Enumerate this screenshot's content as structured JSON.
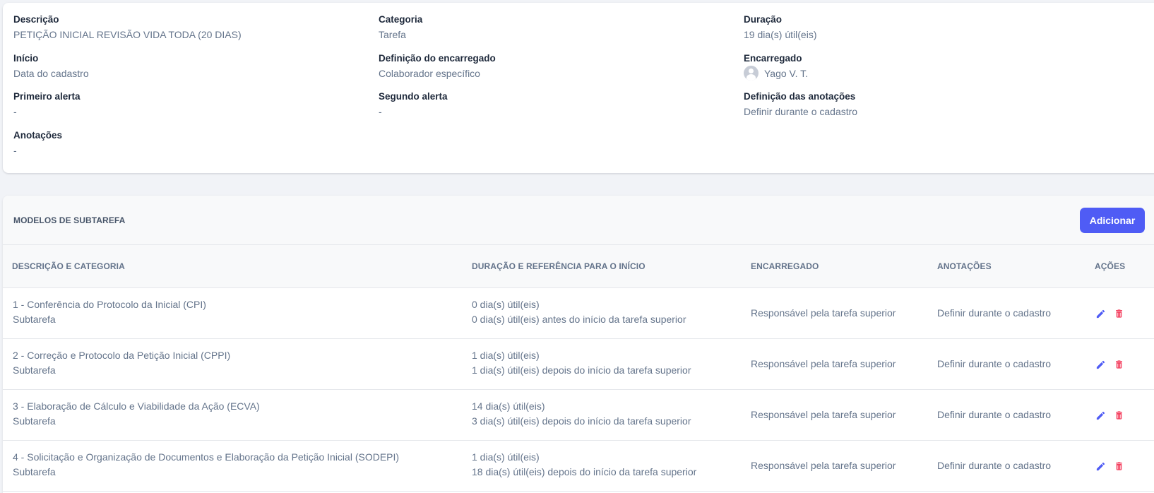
{
  "details": {
    "descricao": {
      "label": "Descrição",
      "value": "PETIÇÃO INICIAL REVISÃO VIDA TODA (20 DIAS)"
    },
    "categoria": {
      "label": "Categoria",
      "value": "Tarefa"
    },
    "duracao": {
      "label": "Duração",
      "value": "19 dia(s) útil(eis)"
    },
    "inicio": {
      "label": "Início",
      "value": "Data do cadastro"
    },
    "definicao_encarregado": {
      "label": "Definição do encarregado",
      "value": "Colaborador específico"
    },
    "encarregado": {
      "label": "Encarregado",
      "value": "Yago V. T."
    },
    "primeiro_alerta": {
      "label": "Primeiro alerta",
      "value": "-"
    },
    "segundo_alerta": {
      "label": "Segundo alerta",
      "value": "-"
    },
    "definicao_anotacoes": {
      "label": "Definição das anotações",
      "value": "Definir durante o cadastro"
    },
    "anotacoes": {
      "label": "Anotações",
      "value": "-"
    }
  },
  "subtasks": {
    "title": "MODELOS DE SUBTAREFA",
    "add_label": "Adicionar",
    "columns": [
      "DESCRIÇÃO E CATEGORIA",
      "DURAÇÃO E REFERÊNCIA PARA O INÍCIO",
      "ENCARREGADO",
      "ANOTAÇÕES",
      "AÇÕES"
    ],
    "rows": [
      {
        "description": "1 - Conferência do Protocolo da Inicial (CPI)",
        "category": "Subtarefa",
        "duration": "0 dia(s) útil(eis)",
        "reference": "0 dia(s) útil(eis) antes do início da tarefa superior",
        "assignee": "Responsável pela tarefa superior",
        "notes": "Definir durante o cadastro"
      },
      {
        "description": "2 - Correção e Protocolo da Petição Inicial (CPPI)",
        "category": "Subtarefa",
        "duration": "1 dia(s) útil(eis)",
        "reference": "1 dia(s) útil(eis) depois do início da tarefa superior",
        "assignee": "Responsável pela tarefa superior",
        "notes": "Definir durante o cadastro"
      },
      {
        "description": "3 - Elaboração de Cálculo e Viabilidade da Ação (ECVA)",
        "category": "Subtarefa",
        "duration": "14 dia(s) útil(eis)",
        "reference": "3 dia(s) útil(eis) depois do início da tarefa superior",
        "assignee": "Responsável pela tarefa superior",
        "notes": "Definir durante o cadastro"
      },
      {
        "description": "4 - Solicitação e Organização de Documentos e Elaboração da Petição Inicial (SODEPI)",
        "category": "Subtarefa",
        "duration": "1 dia(s) útil(eis)",
        "reference": "18 dia(s) útil(eis) depois do início da tarefa superior",
        "assignee": "Responsável pela tarefa superior",
        "notes": "Definir durante o cadastro"
      }
    ]
  },
  "colors": {
    "accent": "#4f5cf5",
    "edit_icon": "#4f5cf5",
    "delete_icon": "#f43f5e"
  },
  "icons": {
    "edit": "pencil-icon",
    "delete": "trash-icon",
    "avatar": "user-avatar-icon"
  }
}
